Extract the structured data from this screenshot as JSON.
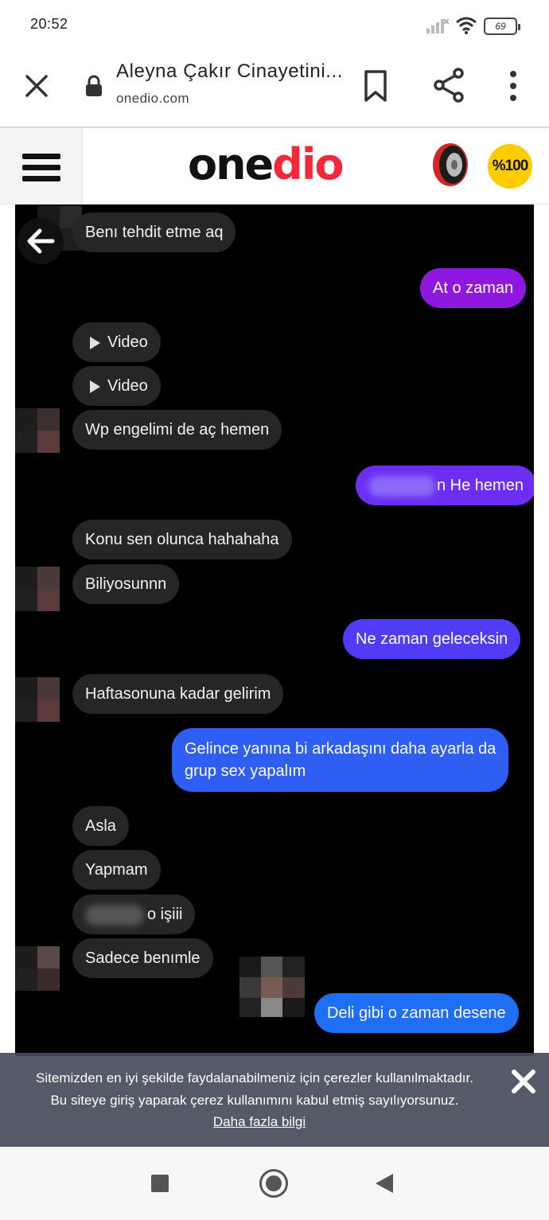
{
  "status_bar": {
    "time": "20:52",
    "battery": "69",
    "icons": [
      "signal-icon",
      "wifi-icon",
      "battery-icon"
    ]
  },
  "browser": {
    "title": "Aleyna Çakır Cinayetini...",
    "url": "onedio.com",
    "icons": [
      "close-icon",
      "lock-icon",
      "bookmark-icon",
      "share-icon",
      "more-vert-icon"
    ]
  },
  "site_header": {
    "logo_black": "one",
    "logo_red": "dio",
    "badge_text": "%100",
    "icons": [
      "hamburger-menu-icon",
      "tire-icon"
    ]
  },
  "chat": {
    "messages": [
      {
        "side": "received",
        "text": "Benı tehdit etme aq"
      },
      {
        "side": "sent",
        "text": "At o zaman",
        "color": "#8e18e0"
      },
      {
        "side": "received",
        "text": "Video",
        "icon": "play-icon"
      },
      {
        "side": "received",
        "text": "Video",
        "icon": "play-icon"
      },
      {
        "side": "received",
        "text": "Wp engelimi de aç hemen"
      },
      {
        "side": "sent",
        "text": "n He hemen",
        "color": "#6c2ef2"
      },
      {
        "side": "received",
        "text": "Konu sen olunca hahahaha"
      },
      {
        "side": "received",
        "text": "Biliyosunnn"
      },
      {
        "side": "sent",
        "text": "Ne zaman geleceksin",
        "color": "#4f3cf4"
      },
      {
        "side": "received",
        "text": "Haftasonuna kadar gelirim"
      },
      {
        "side": "sent",
        "text_line1": "Gelince yanına bi arkadaşını daha ayarla da",
        "text_line2": "grup sex yapalım",
        "color": "#2f5ef5"
      },
      {
        "side": "received",
        "text": "Asla"
      },
      {
        "side": "received",
        "text": "Yapmam"
      },
      {
        "side": "received",
        "text": "o işiii"
      },
      {
        "side": "received",
        "text": "Sadece benımle"
      },
      {
        "side": "sent",
        "text": "Deli gibi o zaman desene",
        "color": "#1f6ef6"
      }
    ]
  },
  "cookie_banner": {
    "line1": "Sitemizden en iyi şekilde faydalanabilmeniz için çerezler kullanılmaktadır.",
    "line2": "Bu siteye giriş yaparak çerez kullanımını kabul etmiş sayılıyorsunuz.",
    "link": "Daha fazla bilgi"
  },
  "nav_bar": {
    "icons": [
      "recent-apps-icon",
      "home-icon",
      "back-icon"
    ]
  }
}
